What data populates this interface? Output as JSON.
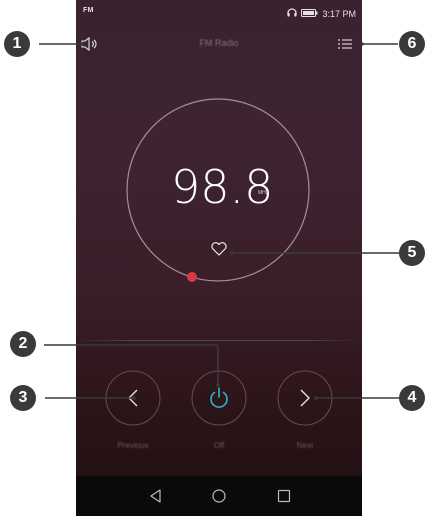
{
  "status_bar": {
    "app_indicator": "FM",
    "time": "3:17 PM",
    "icons": [
      "headphones-icon",
      "battery-icon"
    ]
  },
  "header": {
    "title": "FM Radio",
    "speaker_icon": "speaker-icon",
    "menu_icon": "list-menu-icon"
  },
  "tuner": {
    "frequency": "98.8",
    "unit": "MHz",
    "favorite_icon": "heart-icon",
    "marker_color": "#d93a3a"
  },
  "controls": {
    "previous_label": "Previous",
    "power_label": "Off",
    "next_label": "Next",
    "power_color": "#2fb7c4"
  },
  "nav": {
    "icons": [
      "back-icon",
      "home-icon",
      "recents-icon"
    ]
  },
  "callouts": [
    "1",
    "2",
    "3",
    "4",
    "5",
    "6"
  ]
}
